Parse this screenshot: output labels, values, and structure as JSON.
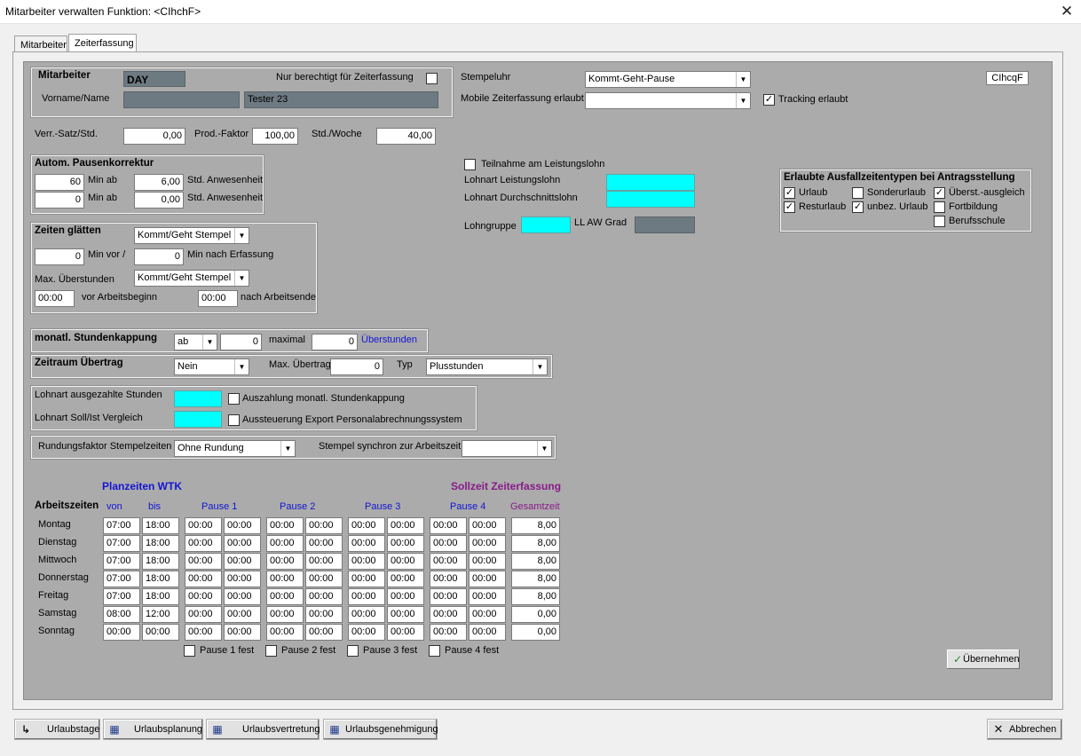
{
  "window": {
    "title": "Mitarbeiter verwalten Funktion: <CIhchF>"
  },
  "tabs": [
    "Mitarbeiter",
    "Zeiterfassung"
  ],
  "top_right_code": "CIhcqF",
  "mitarbeiter": {
    "heading": "Mitarbeiter",
    "code": "DAY",
    "nur_label": "Nur berechtigt für Zeiterfassung",
    "name_label": "Vorname/Name",
    "vorname": "",
    "nachname": "Tester 23"
  },
  "stempeluhr": {
    "label": "Stempeluhr",
    "value": "Kommt-Geht-Pause"
  },
  "mobile": {
    "label": "Mobile Zeiterfassung erlaubt",
    "value": ""
  },
  "tracking": {
    "label": "Tracking erlaubt",
    "checked": true
  },
  "satz": {
    "verr_label": "Verr.-Satz/Std.",
    "verr_value": "0,00",
    "prod_label": "Prod.-Faktor",
    "prod_value": "100,00",
    "woche_label": "Std./Woche",
    "woche_value": "40,00"
  },
  "pause": {
    "heading": "Autom. Pausenkorrektur",
    "rows": [
      {
        "min": "60",
        "min_label": "Min ab",
        "std": "6,00",
        "std_label": "Std. Anwesenheit"
      },
      {
        "min": "0",
        "min_label": "Min ab",
        "std": "0,00",
        "std_label": "Std. Anwesenheit"
      }
    ]
  },
  "glaetten": {
    "heading": "Zeiten glätten",
    "select1": "Kommt/Geht Stempel",
    "vor_value": "0",
    "vor_label": "Min vor /",
    "nach_value": "0",
    "nach_label": "Min nach Erfassung",
    "max_label": "Max. Überstunden",
    "select2": "Kommt/Geht Stempel",
    "beginn_value": "00:00",
    "beginn_label": "vor Arbeitsbeginn",
    "ende_value": "00:00",
    "ende_label": "nach Arbeitsende"
  },
  "kappung": {
    "heading": "monatl. Stundenkappung",
    "select": "ab",
    "value1": "0",
    "max_label": "maximal",
    "value2": "0",
    "unit": "Überstunden"
  },
  "uebertrag": {
    "heading": "Zeitraum Übertrag",
    "select": "Nein",
    "max_label": "Max. Übertrag",
    "max_value": "0",
    "typ_label": "Typ",
    "typ_value": "Plusstunden"
  },
  "lohnart": {
    "label1": "Lohnart ausgezahlte Stunden",
    "value1": "",
    "chk1_label": "Auszahlung monatl. Stundenkappung",
    "label2": "Lohnart Soll/Ist Vergleich",
    "value2": "",
    "chk2_label": "Aussteuerung Export Personalabrechnungssystem"
  },
  "rundung": {
    "label": "Rundungsfaktor Stempelzeiten",
    "value": "Ohne Rundung",
    "synchron_label": "Stempel synchron zur Arbeitszeit",
    "synchron_value": ""
  },
  "leistung": {
    "teilnahme_label": "Teilnahme am Leistungslohn",
    "lohnart_label": "Lohnart Leistungslohn",
    "durchschnitt_label": "Lohnart Durchschnittslohn",
    "lohngruppe_label": "Lohngruppe",
    "aw_label": "LL AW Grad"
  },
  "ausfall": {
    "heading": "Erlaubte Ausfallzeitentypen bei Antragsstellung",
    "items": [
      {
        "label": "Urlaub",
        "checked": true
      },
      {
        "label": "Sonderurlaub",
        "checked": false
      },
      {
        "label": "Überst.-ausgleich",
        "checked": true
      },
      {
        "label": "Resturlaub",
        "checked": true
      },
      {
        "label": "unbez. Urlaub",
        "checked": true
      },
      {
        "label": "Fortbildung",
        "checked": false
      },
      {
        "label": "Berufsschule",
        "checked": false
      }
    ]
  },
  "arbeitszeiten": {
    "planzeiten_title": "Planzeiten WTK",
    "sollzeit_title": "Sollzeit Zeiterfassung",
    "row_heading": "Arbeitszeiten",
    "columns": [
      "von",
      "bis",
      "Pause 1",
      "Pause 2",
      "Pause 3",
      "Pause 4",
      "Gesamtzeit"
    ],
    "days": [
      {
        "day": "Montag",
        "von": "07:00",
        "bis": "18:00",
        "total": "8,00"
      },
      {
        "day": "Dienstag",
        "von": "07:00",
        "bis": "18:00",
        "total": "8,00"
      },
      {
        "day": "Mittwoch",
        "von": "07:00",
        "bis": "18:00",
        "total": "8,00"
      },
      {
        "day": "Donnerstag",
        "von": "07:00",
        "bis": "18:00",
        "total": "8,00"
      },
      {
        "day": "Freitag",
        "von": "07:00",
        "bis": "18:00",
        "total": "8,00"
      },
      {
        "day": "Samstag",
        "von": "08:00",
        "bis": "12:00",
        "total": "0,00"
      },
      {
        "day": "Sonntag",
        "von": "00:00",
        "bis": "00:00",
        "total": "0,00"
      }
    ],
    "pause_time": "00:00",
    "fest_labels": [
      "Pause 1 fest",
      "Pause 2 fest",
      "Pause 3 fest",
      "Pause 4 fest"
    ]
  },
  "buttons": {
    "uebernehmen": "Übernehmen",
    "urlaubstage": "Urlaubstage",
    "urlaubsplanung": "Urlaubsplanung",
    "urlaubsvertretung": "Urlaubsvertretung",
    "urlaubsgenehmigung": "Urlaubsgenehmigung",
    "abbrechen": "Abbrechen"
  }
}
